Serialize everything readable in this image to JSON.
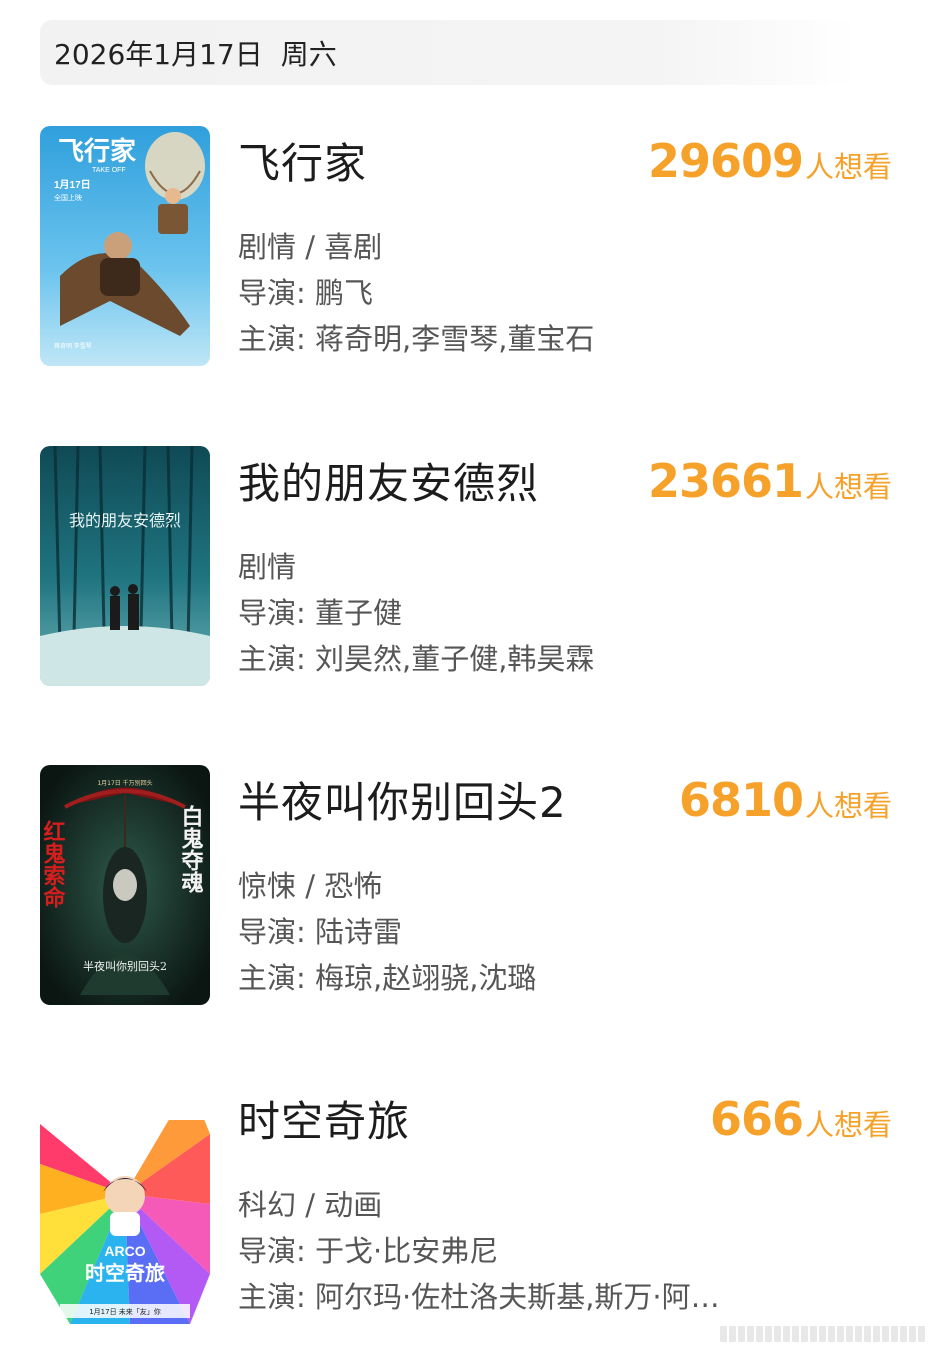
{
  "date_bar": {
    "date": "2026年1月17日",
    "weekday": "周六"
  },
  "wish_suffix": "人想看",
  "labels": {
    "director": "导演: ",
    "cast": "主演: "
  },
  "movies": [
    {
      "title": "飞行家",
      "wish_count": "29609",
      "genre": "剧情 / 喜剧",
      "director": "鹏飞",
      "cast": "蒋奇明,李雪琴,董宝石",
      "poster": {
        "title_text": "飞行家",
        "subtitle_text": "TAKE OFF",
        "date_text": "1月17日",
        "release_text": "全国上映",
        "names_text": "蒋奇明  李雪琴"
      }
    },
    {
      "title": "我的朋友安德烈",
      "wish_count": "23661",
      "genre": "剧情",
      "director": "董子健",
      "cast": "刘昊然,董子健,韩昊霖",
      "poster": {
        "title_text": "我的朋友安德烈"
      }
    },
    {
      "title": "半夜叫你别回头2",
      "wish_count": "6810",
      "genre": "惊悚 / 恐怖",
      "director": "陆诗雷",
      "cast": "梅琼,赵翊骁,沈璐",
      "poster": {
        "left_text": "红鬼索命",
        "right_text": "白鬼夺魂",
        "top_text": "1月17日 千万别回头",
        "title_text": "半夜叫你别回头2"
      }
    },
    {
      "title": "时空奇旅",
      "wish_count": "666",
      "genre": "科幻 / 动画",
      "director": "于戈·比安弗尼",
      "cast": "阿尔玛·佐杜洛夫斯基,斯万·阿…",
      "poster": {
        "brand_text": "ARCO",
        "title_text": "时空奇旅",
        "date_text": "1月17日 未来「友」你"
      }
    }
  ]
}
